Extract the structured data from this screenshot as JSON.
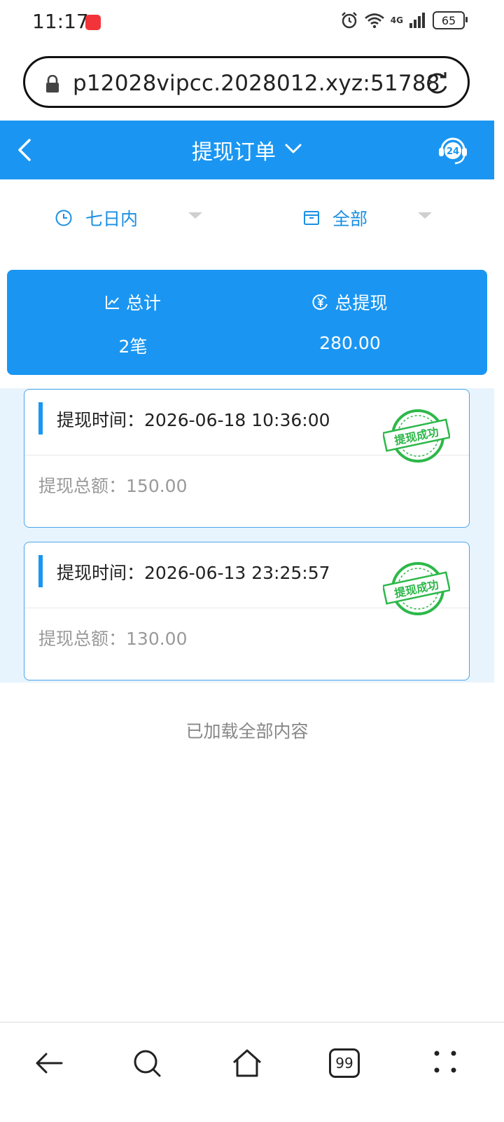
{
  "status_bar": {
    "time": "11:17",
    "network": "4G",
    "battery": "65",
    "icons": [
      "alarm-icon",
      "wifi-icon",
      "signal-icon",
      "battery-icon"
    ]
  },
  "browser": {
    "url": "p12028vipcc.2028012.xyz:51788"
  },
  "header": {
    "title": "提现订单"
  },
  "filters": {
    "period": "七日内",
    "category": "全部"
  },
  "summary": {
    "total_label": "总计",
    "total_value": "2笔",
    "withdraw_label": "总提现",
    "withdraw_value": "280.00"
  },
  "orders": [
    {
      "time_label": "提现时间：",
      "time": "2026-06-18 10:36:00",
      "amount_label": "提现总额：",
      "amount": "150.00",
      "stamp": "提现成功"
    },
    {
      "time_label": "提现时间：",
      "time": "2026-06-13 23:25:57",
      "amount_label": "提现总额：",
      "amount": "130.00",
      "stamp": "提现成功"
    }
  ],
  "list_end_text": "已加载全部内容",
  "bottom_nav": {
    "tabs_count": "99"
  },
  "colors": {
    "primary": "#1a96f2",
    "stamp_green": "#2db84a",
    "list_bg": "#e8f4fd"
  }
}
